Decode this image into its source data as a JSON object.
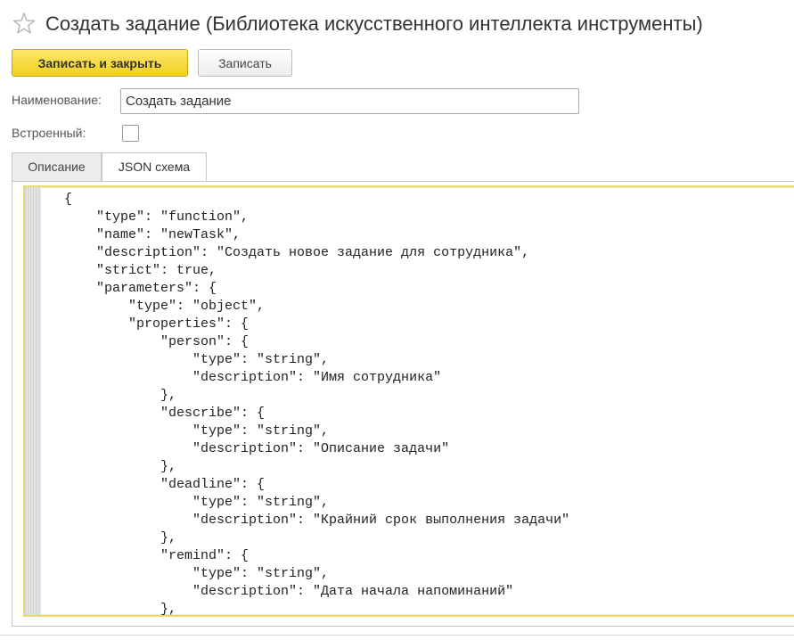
{
  "header": {
    "title": "Создать задание (Библиотека искусственного интеллекта инструменты)",
    "favorite_icon": "star-outline-icon"
  },
  "toolbar": {
    "save_close_label": "Записать и закрыть",
    "save_label": "Записать"
  },
  "form": {
    "name_label": "Наименование:",
    "name_value": "Создать задание",
    "builtin_label": "Встроенный:",
    "builtin_checked": false
  },
  "tabs": {
    "items": [
      {
        "label": "Описание",
        "active": false
      },
      {
        "label": "JSON схема",
        "active": true
      }
    ]
  },
  "editor": {
    "lines": [
      "{",
      "    \"type\": \"function\",",
      "    \"name\": \"newTask\",",
      "    \"description\": \"Создать новое задание для сотрудника\",",
      "    \"strict\": true,",
      "    \"parameters\": {",
      "        \"type\": \"object\",",
      "        \"properties\": {",
      "            \"person\": {",
      "                \"type\": \"string\",",
      "                \"description\": \"Имя сотрудника\"",
      "            },",
      "            \"describe\": {",
      "                \"type\": \"string\",",
      "                \"description\": \"Описание задачи\"",
      "            },",
      "            \"deadline\": {",
      "                \"type\": \"string\",",
      "                \"description\": \"Крайний срок выполнения задачи\"",
      "            },",
      "            \"remind\": {",
      "                \"type\": \"string\",",
      "                \"description\": \"Дата начала напоминаний\"",
      "            },"
    ]
  },
  "colors": {
    "primary_button": "#f2cf1f",
    "editor_border": "#e6d97a"
  }
}
